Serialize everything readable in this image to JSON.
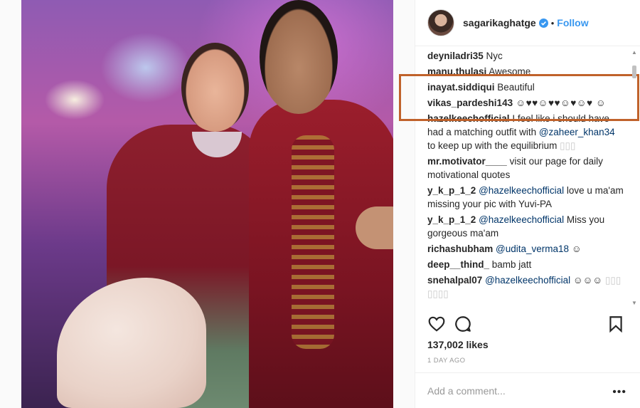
{
  "post": {
    "username": "sagarikaghatge",
    "follow_label": "Follow",
    "separator": "•",
    "likes": "137,002 likes",
    "timestamp": "1 DAY AGO",
    "add_comment_placeholder": "Add a comment...",
    "more_label": "•••"
  },
  "comments": [
    {
      "user": "deyniladri35",
      "text": " Nyc"
    },
    {
      "user": "manu.thulasi",
      "text": " Awesome"
    },
    {
      "user": "inayat.siddiqui",
      "text": " Beautiful"
    },
    {
      "user": "vikas_pardeshi143",
      "text": " ☺♥♥☺♥♥☺♥☺♥ ☺"
    },
    {
      "user": "hazelkeechofficial",
      "pre": " I feel like i should have had a matching outfit with ",
      "mention": "@zaheer_khan34",
      "post": " to keep up with the equilibrium",
      "faded": " ▯▯▯"
    },
    {
      "user": "mr.motivator____",
      "text": " visit our page for daily motivational quotes"
    },
    {
      "user": "y_k_p_1_2",
      "mention": "@hazelkeechofficial",
      "post": " love u ma'am missing your pic with Yuvi-PA"
    },
    {
      "user": "y_k_p_1_2",
      "mention": "@hazelkeechofficial",
      "post": " Miss you gorgeous ma'am"
    },
    {
      "user": "richashubham",
      "mention": "@udita_verma18",
      "post": " ☺"
    },
    {
      "user": "deep__thind_",
      "text": " bamb jatt"
    },
    {
      "user": "snehalpal07",
      "mention": "@hazelkeechofficial",
      "post": " ☺☺☺",
      "faded": "▯▯▯ ▯▯▯▯"
    }
  ],
  "icons": {
    "verified": "verified-badge-icon",
    "like": "heart-icon",
    "comment": "comment-bubble-icon",
    "save": "bookmark-icon"
  },
  "colors": {
    "follow": "#3897f0",
    "mention": "#003569",
    "highlight_box": "#c0622b"
  }
}
